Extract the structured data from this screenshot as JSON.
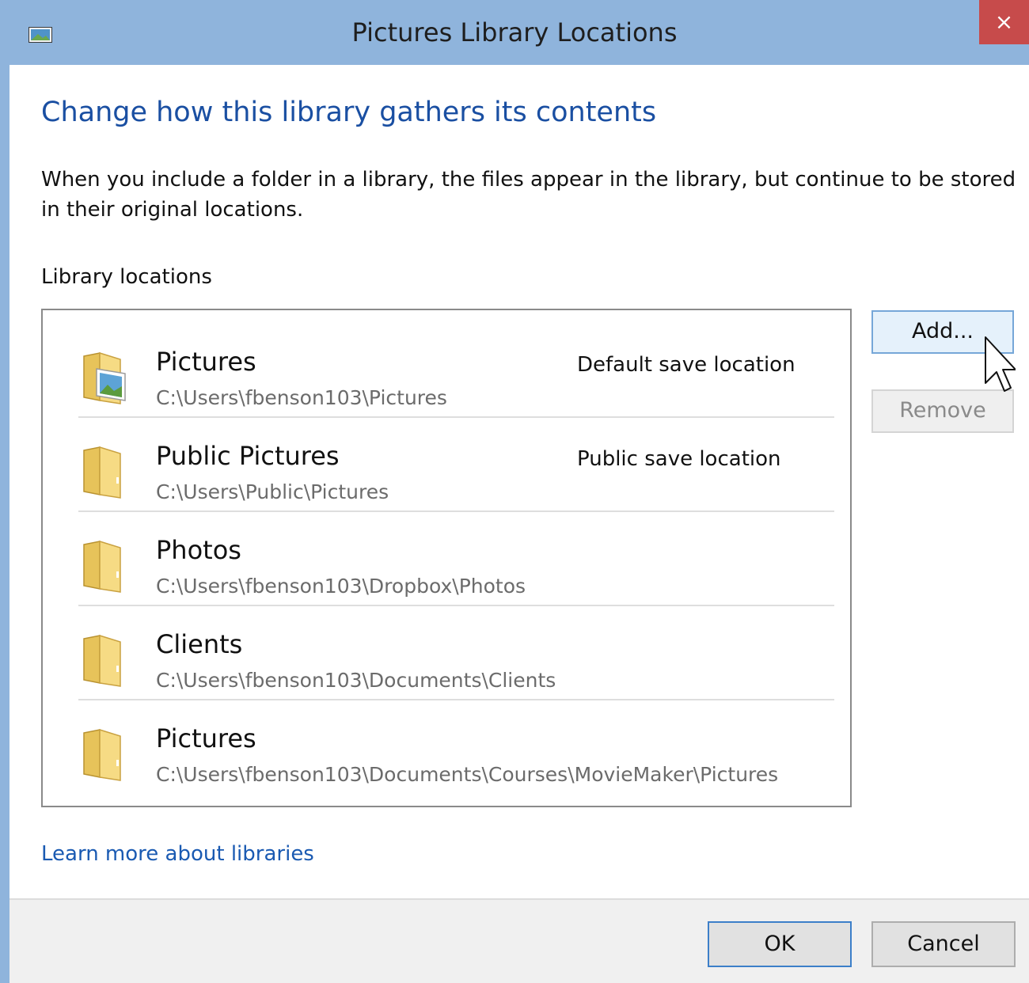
{
  "window": {
    "title": "Pictures Library Locations",
    "close_label": "×",
    "icon": "pictures-library-icon"
  },
  "main": {
    "heading": "Change how this library gathers its contents",
    "description": "When you include a folder in a library, the files appear in the library, but continue to be stored in their original locations.",
    "section_label": "Library locations",
    "locations": [
      {
        "name": "Pictures",
        "path": "C:\\Users\\fbenson103\\Pictures",
        "note": "Default save location",
        "icon": "pictures-folder-icon"
      },
      {
        "name": "Public Pictures",
        "path": "C:\\Users\\Public\\Pictures",
        "note": "Public save location",
        "icon": "folder-icon"
      },
      {
        "name": "Photos",
        "path": "C:\\Users\\fbenson103\\Dropbox\\Photos",
        "note": "",
        "icon": "folder-icon"
      },
      {
        "name": "Clients",
        "path": "C:\\Users\\fbenson103\\Documents\\Clients",
        "note": "",
        "icon": "folder-icon"
      },
      {
        "name": "Pictures",
        "path": "C:\\Users\\fbenson103\\Documents\\Courses\\MovieMaker\\Pictures",
        "note": "",
        "icon": "folder-icon"
      }
    ],
    "add_label": "Add...",
    "remove_label": "Remove",
    "learn_more": "Learn more about libraries"
  },
  "footer": {
    "ok_label": "OK",
    "cancel_label": "Cancel"
  },
  "colors": {
    "title_bar": "#8fb4dc",
    "close_button": "#c74b4b",
    "heading": "#1a4fa2",
    "link": "#1a5ab2"
  }
}
